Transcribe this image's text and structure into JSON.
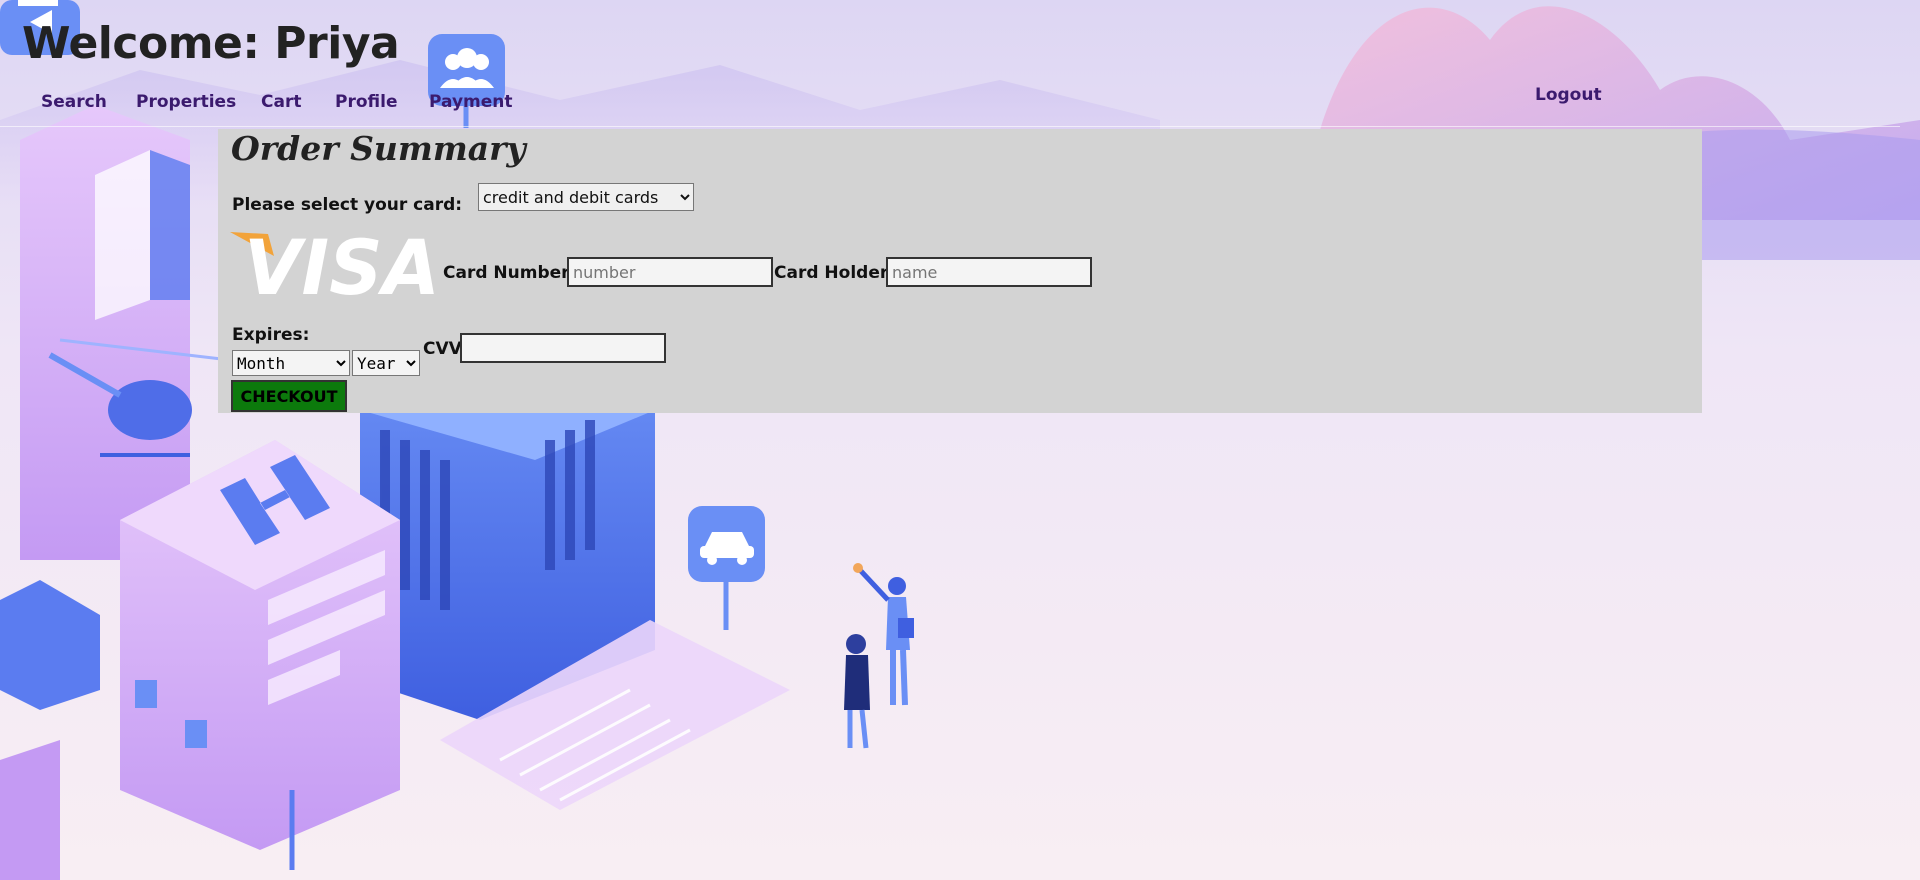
{
  "header": {
    "welcome": "Welcome: Priya"
  },
  "nav": {
    "search": "Search",
    "properties": "Properties",
    "cart": "Cart",
    "profile": "Profile",
    "payment": "Payment",
    "logout": "Logout"
  },
  "order": {
    "title": "Order Summary",
    "select_card_label": "Please select your card:",
    "card_type_selected": "credit and debit cards",
    "visa_logo_text": "VISA",
    "card_number_label": "Card Number:",
    "card_number_placeholder": "number",
    "card_holder_label": "Card Holder:",
    "card_holder_placeholder": "name",
    "expires_label": "Expires:",
    "month_selected": "Month",
    "year_selected": "Year",
    "cvv_label": "CVV",
    "checkout_label": "CHECKOUT"
  },
  "colors": {
    "nav_text": "#3b1a6e",
    "panel_bg": "#d3d3d3",
    "checkout_bg": "#0c7a0c"
  },
  "icons": [
    "film-icon",
    "users-icon",
    "car-pin-icon",
    "visa-logo"
  ]
}
